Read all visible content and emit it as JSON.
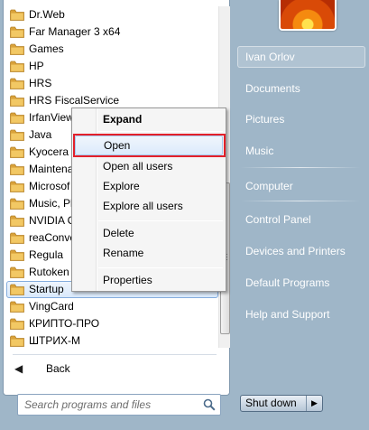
{
  "programs": [
    {
      "label": "Dr.Web"
    },
    {
      "label": "Far Manager 3 x64"
    },
    {
      "label": "Games"
    },
    {
      "label": "HP"
    },
    {
      "label": "HRS"
    },
    {
      "label": "HRS FiscalService"
    },
    {
      "label": "IrfanView"
    },
    {
      "label": "Java"
    },
    {
      "label": "Kyocera"
    },
    {
      "label": "Maintena"
    },
    {
      "label": "Microsof"
    },
    {
      "label": "Music, Pl"
    },
    {
      "label": "NVIDIA C"
    },
    {
      "label": "reaConve"
    },
    {
      "label": "Regula"
    },
    {
      "label": "Rutoken"
    },
    {
      "label": "Startup",
      "selected": true
    },
    {
      "label": "VingCard"
    },
    {
      "label": "КРИПТО-ПРО"
    },
    {
      "label": "ШТРИХ-М"
    }
  ],
  "back": {
    "label": "Back"
  },
  "search": {
    "placeholder": "Search programs and files"
  },
  "right_pane": {
    "items": [
      "Ivan Orlov",
      "Documents",
      "Pictures",
      "Music",
      "Computer",
      "Control Panel",
      "Devices and Printers",
      "Default Programs",
      "Help and Support"
    ]
  },
  "shutdown": {
    "label": "Shut down"
  },
  "context_menu": {
    "items": [
      "Expand",
      "Open",
      "Open all users",
      "Explore",
      "Explore all users",
      "Delete",
      "Rename",
      "Properties"
    ]
  },
  "colors": {
    "highlight": "#e3202a",
    "folder": "#e8b548",
    "pane_background": "#9fb6c8"
  }
}
